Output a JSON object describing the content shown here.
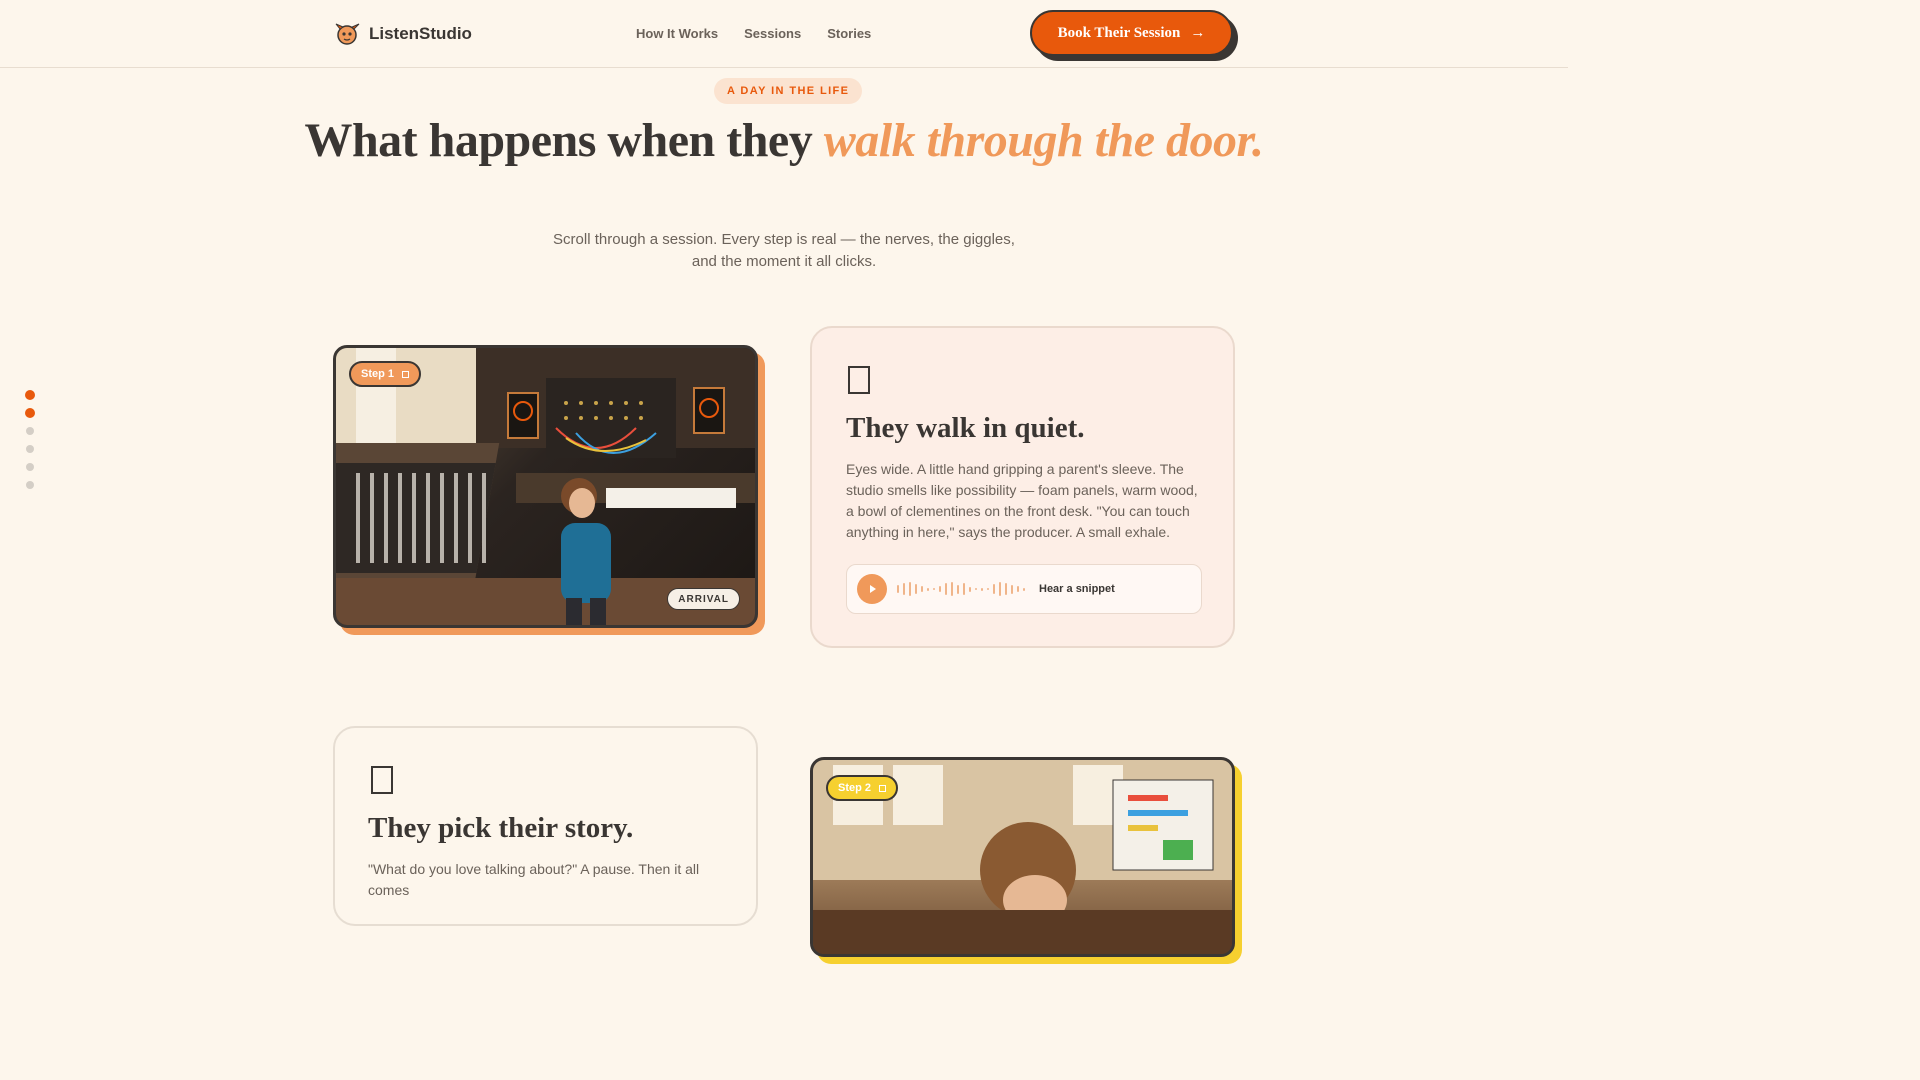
{
  "brand": {
    "name": "ListenStudio"
  },
  "nav": {
    "items": [
      "How It Works",
      "Sessions",
      "Stories"
    ]
  },
  "cta": {
    "label": "Book Their Session",
    "arrow": "→"
  },
  "scroll_indicator": {
    "total": 6,
    "active": [
      0,
      1
    ]
  },
  "hero": {
    "eyebrow": "A DAY IN THE LIFE",
    "title_plain": "What happens when they",
    "title_accent": "walk through the door.",
    "subtitle": "Scroll through a session. Every step is real — the nerves, the giggles, and the moment it all clicks."
  },
  "steps": [
    {
      "pill": "Step 1",
      "badge": "ARRIVAL",
      "title": "They walk in quiet.",
      "body": "Eyes wide. A little hand gripping a parent's sleeve. The studio smells like possibility — foam panels, warm wood, a bowl of clementines on the front desk. \"You can touch anything in here,\" says the producer. A small exhale.",
      "audio_label": "Hear a snippet",
      "accent": "#f0995a"
    },
    {
      "pill": "Step 2",
      "title": "They pick their story.",
      "body": "\"What do you love talking about?\" A pause. Then it all comes",
      "accent": "#f6d02f"
    }
  ],
  "colors": {
    "brand": "#e8590c",
    "accent_light": "#f0995a",
    "ink": "#3a3633",
    "background": "#fdf6ec",
    "yellow": "#f6d02f"
  }
}
